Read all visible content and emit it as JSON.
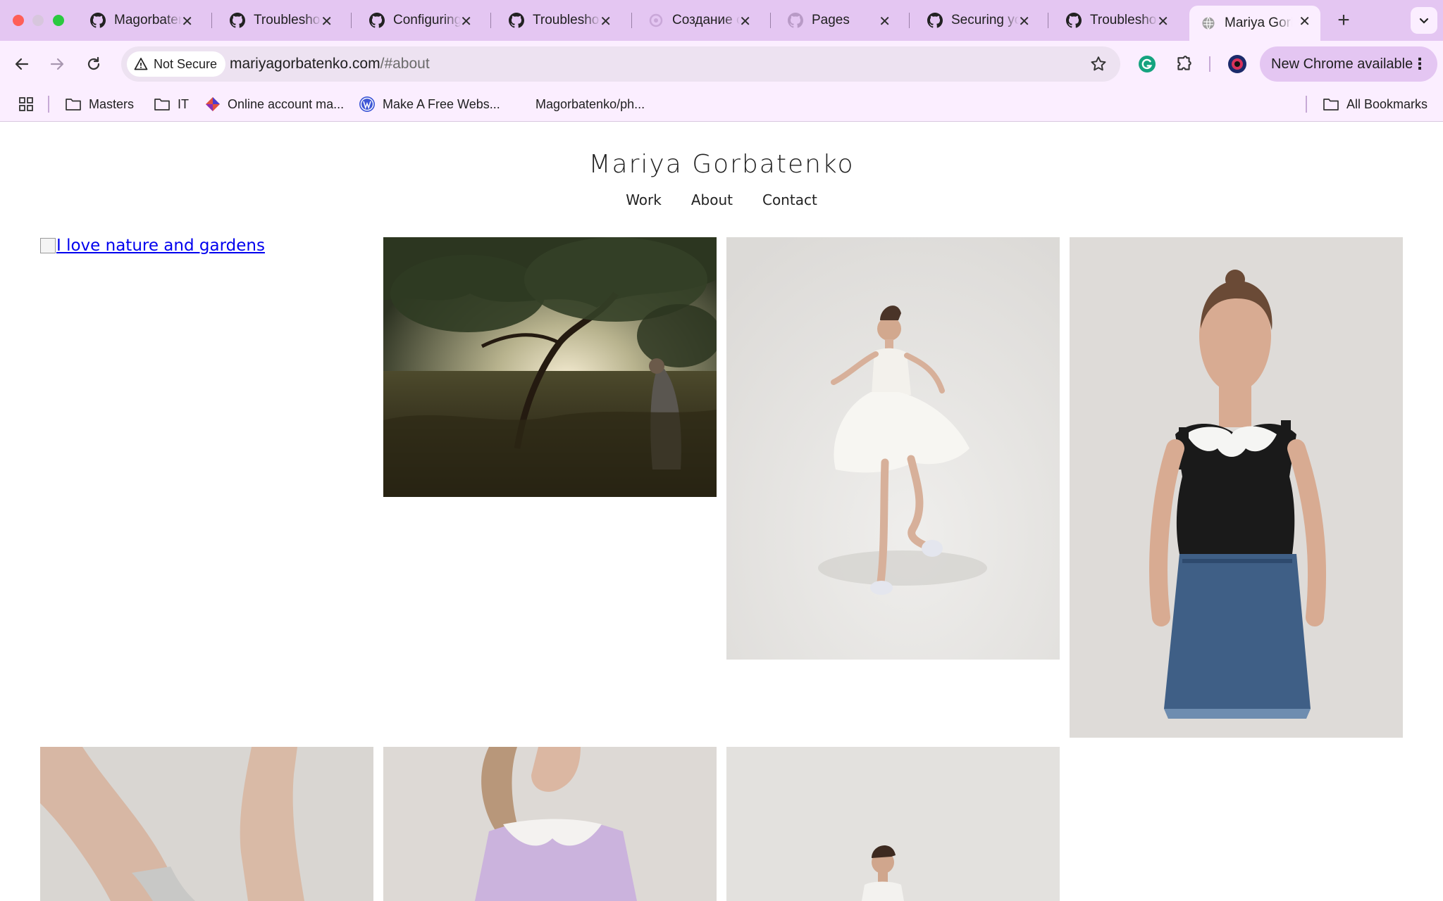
{
  "browser": {
    "tabs": [
      {
        "title": "Magorbatenko",
        "icon": "github-icon",
        "active": false
      },
      {
        "title": "Troubleshooting",
        "icon": "github-icon",
        "active": false
      },
      {
        "title": "Configuring",
        "icon": "github-icon",
        "active": false
      },
      {
        "title": "Troubleshooting",
        "icon": "github-icon",
        "active": false
      },
      {
        "title": "Создание сайта",
        "icon": "openai-icon",
        "active": false
      },
      {
        "title": "Pages",
        "icon": "github-icon",
        "active": false
      },
      {
        "title": "Securing your",
        "icon": "github-icon",
        "active": false
      },
      {
        "title": "Troubleshooting",
        "icon": "github-icon",
        "active": false
      },
      {
        "title": "Mariya Gorbatenko",
        "icon": "globe-icon",
        "active": true
      }
    ],
    "omnibox": {
      "security_label": "Not Secure",
      "url_host": "mariyagorbatenko.com",
      "url_path": "/#about"
    },
    "update_button": "New Chrome available",
    "bookmarks": [
      {
        "label": "Masters",
        "icon": "folder-icon"
      },
      {
        "label": "IT",
        "icon": "folder-icon"
      },
      {
        "label": "Online account ma...",
        "icon": "diamond-icon"
      },
      {
        "label": "Make A Free Webs...",
        "icon": "wordpress-icon"
      },
      {
        "label": "Magorbatenko/ph...",
        "icon": "none"
      }
    ],
    "all_bookmarks": "All Bookmarks"
  },
  "site": {
    "title": "Mariya Gorbatenko",
    "nav": [
      "Work",
      "About",
      "Contact"
    ],
    "broken_image_alt": "I love nature and gardens",
    "photos": [
      {
        "name": "photo-tree-field"
      },
      {
        "name": "photo-white-dress-dancer"
      },
      {
        "name": "photo-black-top-denim-skirt"
      },
      {
        "name": "photo-legs-socks"
      },
      {
        "name": "photo-lilac-top"
      },
      {
        "name": "photo-standing-model"
      }
    ]
  },
  "colors": {
    "tabstrip": "#e4c6f2",
    "toolbar": "#fbeeff",
    "link": "#0000ee"
  }
}
